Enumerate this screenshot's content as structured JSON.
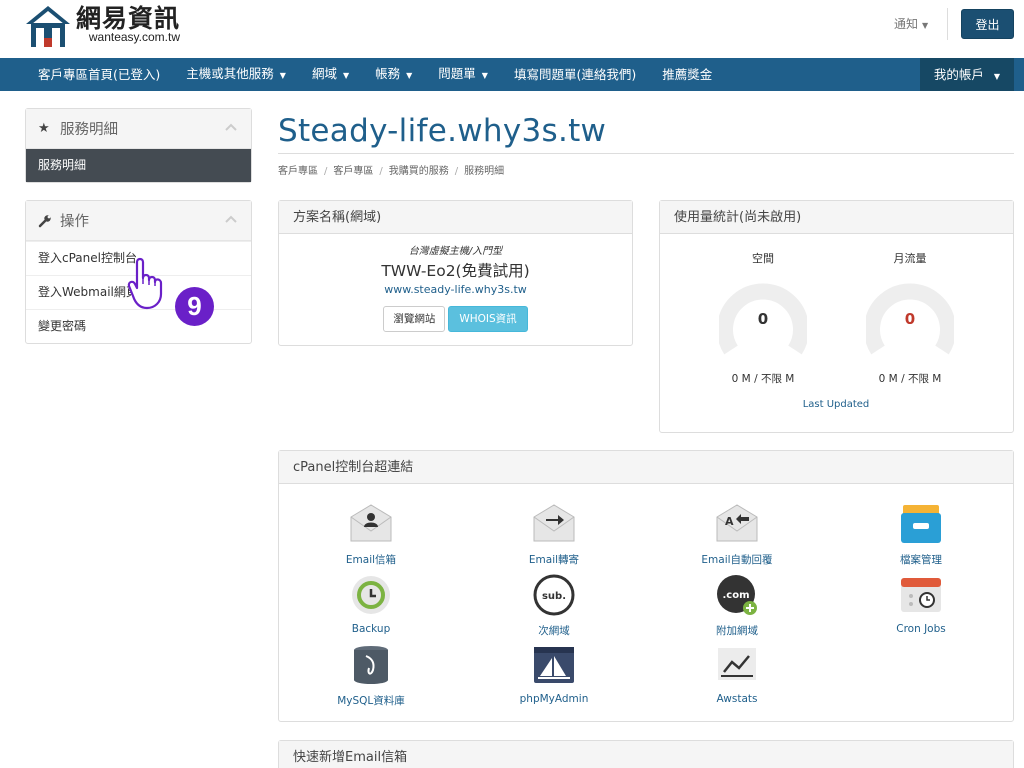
{
  "header": {
    "brand_zh": "網易資訊",
    "brand_en": "wanteasy.com.tw",
    "notify_label": "通知",
    "logout_label": "登出"
  },
  "nav": {
    "items": [
      {
        "label": "客戶專區首頁(已登入)",
        "dropdown": false
      },
      {
        "label": "主機或其他服務",
        "dropdown": true
      },
      {
        "label": "網域",
        "dropdown": true
      },
      {
        "label": "帳務",
        "dropdown": true
      },
      {
        "label": "問題單",
        "dropdown": true
      },
      {
        "label": "填寫問題單(連絡我們)",
        "dropdown": false
      },
      {
        "label": "推薦獎金",
        "dropdown": false
      }
    ],
    "account_label": "我的帳戶"
  },
  "sidebar": {
    "service_panel": {
      "title": "服務明細",
      "active_item": "服務明細",
      "icon": "star-icon"
    },
    "actions_panel": {
      "title": "操作",
      "icon": "wrench-icon",
      "items": [
        "登入cPanel控制台",
        "登入Webmail網頁",
        "變更密碼"
      ]
    }
  },
  "main": {
    "title": "Steady-life.why3s.tw",
    "breadcrumb": [
      "客戶專區",
      "客戶專區",
      "我購買的服務",
      "服務明細"
    ],
    "plan": {
      "header": "方案名稱(網域)",
      "subtitle": "台灣虛擬主機/入門型",
      "name": "TWW-Eo2(免費試用)",
      "domain": "www.steady-life.why3s.tw",
      "browse_label": "瀏覽網站",
      "whois_label": "WHOIS資訊"
    },
    "usage": {
      "header": "使用量統計(尚未啟用)",
      "disk": {
        "label": "空間",
        "value": "0",
        "amount": "0 M / 不限 M",
        "color": "#333333"
      },
      "bandwidth": {
        "label": "月流量",
        "value": "0",
        "amount": "0 M / 不限 M",
        "color": "#c0392b"
      },
      "last_updated": "Last Updated"
    },
    "cpanel": {
      "header": "cPanel控制台超連結",
      "items": [
        {
          "label": "Email信箱",
          "icon": "email-account-icon"
        },
        {
          "label": "Email轉寄",
          "icon": "email-forward-icon"
        },
        {
          "label": "Email自動回覆",
          "icon": "email-autoresponder-icon"
        },
        {
          "label": "檔案管理",
          "icon": "file-manager-icon"
        },
        {
          "label": "Backup",
          "icon": "backup-icon"
        },
        {
          "label": "次網域",
          "icon": "subdomain-icon"
        },
        {
          "label": "附加網域",
          "icon": "addon-domain-icon"
        },
        {
          "label": "Cron Jobs",
          "icon": "cron-jobs-icon"
        },
        {
          "label": "MySQL資料庫",
          "icon": "mysql-icon"
        },
        {
          "label": "phpMyAdmin",
          "icon": "phpmyadmin-icon"
        },
        {
          "label": "Awstats",
          "icon": "awstats-icon"
        }
      ]
    },
    "quick_email": {
      "header": "快速新增Email信箱"
    }
  },
  "annotation": {
    "step": "9"
  }
}
